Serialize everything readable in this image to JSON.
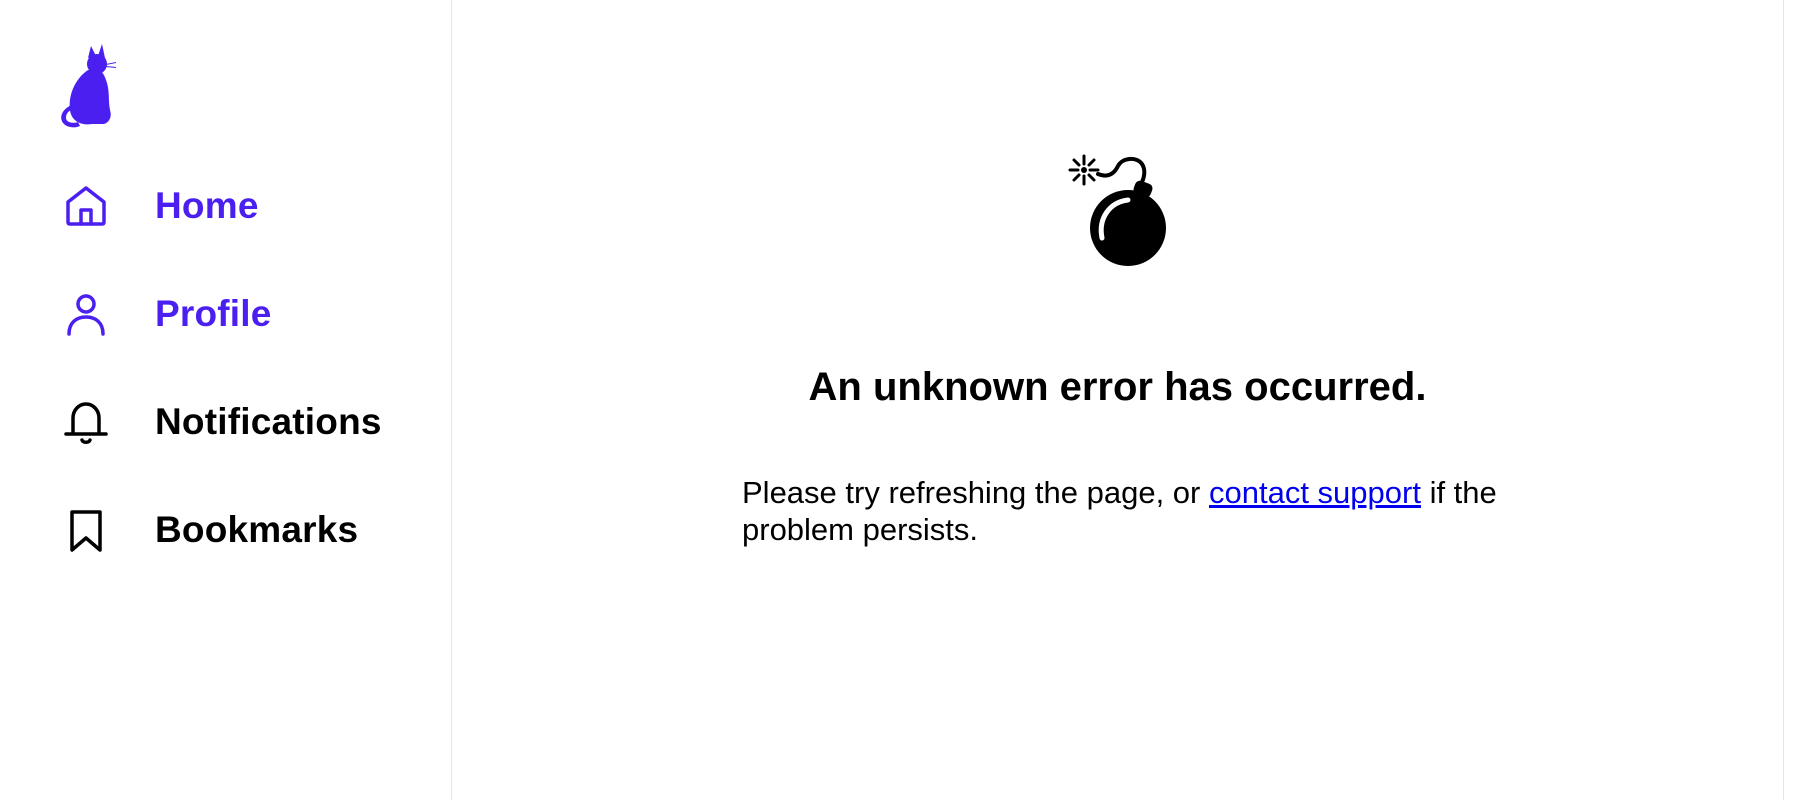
{
  "sidebar": {
    "logo_icon": "cat-logo-icon",
    "items": [
      {
        "label": "Home",
        "icon": "home-icon",
        "color": "#4a1ff0"
      },
      {
        "label": "Profile",
        "icon": "user-icon",
        "color": "#4a1ff0"
      },
      {
        "label": "Notifications",
        "icon": "bell-icon",
        "color": "#000000"
      },
      {
        "label": "Bookmarks",
        "icon": "bookmark-icon",
        "color": "#000000"
      }
    ]
  },
  "main": {
    "illustration_icon": "bomb-icon",
    "title": "An unknown error has occurred.",
    "message_before": "Please try refreshing the page, or ",
    "link_text": "contact support",
    "message_after": " if the problem persists."
  },
  "colors": {
    "accent": "#4a1ff0",
    "link": "#0000ee",
    "text": "#000000",
    "divider": "#e6e6e6"
  }
}
